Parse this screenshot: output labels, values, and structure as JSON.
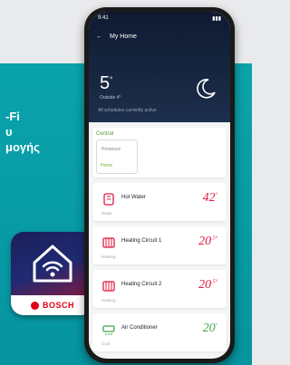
{
  "promo": {
    "line1": "-Fi",
    "line2": "υ",
    "line3": "μογής"
  },
  "app_icon": {
    "brand": "BOSCH"
  },
  "status_bar": {
    "time": "9:41",
    "signal": "▮▮▮"
  },
  "header": {
    "back": "←",
    "title": "My Home",
    "temperature": "5",
    "degree": "°",
    "sub": "Outside 4°",
    "info": "All schedules currently active"
  },
  "group": {
    "title": "Central",
    "tile_name": "Presence",
    "tile_status": "Home"
  },
  "rooms": [
    {
      "name": "Hot Water",
      "sub": "Water",
      "value": "42",
      "unit": "°",
      "color": "#e0183f"
    },
    {
      "name": "Heating Circuit 1",
      "sub": "Heating",
      "value": "20",
      "unit": ".5°",
      "color": "#e0183f"
    },
    {
      "name": "Heating Circuit 2",
      "sub": "Heating",
      "value": "20",
      "unit": ".5°",
      "color": "#e0183f"
    },
    {
      "name": "Air Conditioner",
      "sub": "Cool",
      "value": "20",
      "unit": "°",
      "color": "#3aa84c"
    }
  ]
}
